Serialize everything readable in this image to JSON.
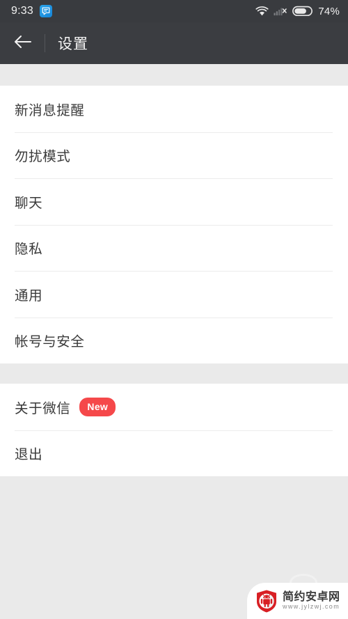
{
  "status_bar": {
    "clock": "9:33",
    "app_icon": "chat-bubble-icon",
    "wifi_icon": "wifi-icon",
    "signal_icon": "signal-no-service-icon",
    "battery_icon": "battery-icon",
    "battery_percent": "74%"
  },
  "action_bar": {
    "back_icon": "back-arrow-icon",
    "title": "设置"
  },
  "settings": {
    "group_one": [
      {
        "label": "新消息提醒"
      },
      {
        "label": "勿扰模式"
      },
      {
        "label": "聊天"
      },
      {
        "label": "隐私"
      },
      {
        "label": "通用"
      },
      {
        "label": "帐号与安全"
      }
    ],
    "group_two": [
      {
        "label": "关于微信",
        "badge": "New"
      },
      {
        "label": "退出"
      }
    ]
  },
  "watermark": {
    "logo_icon": "android-shield-logo",
    "title": "简约安卓网",
    "url": "www.jylzwj.com"
  },
  "colors": {
    "status_bar_bg": "#393b3f",
    "action_bar_bg": "#3b3d41",
    "page_bg": "#eaeaea",
    "card_bg": "#ffffff",
    "divider": "#ececec",
    "badge_red": "#f5484a",
    "text_primary": "#3a3a3a",
    "app_icon_blue": "#1785d8"
  }
}
